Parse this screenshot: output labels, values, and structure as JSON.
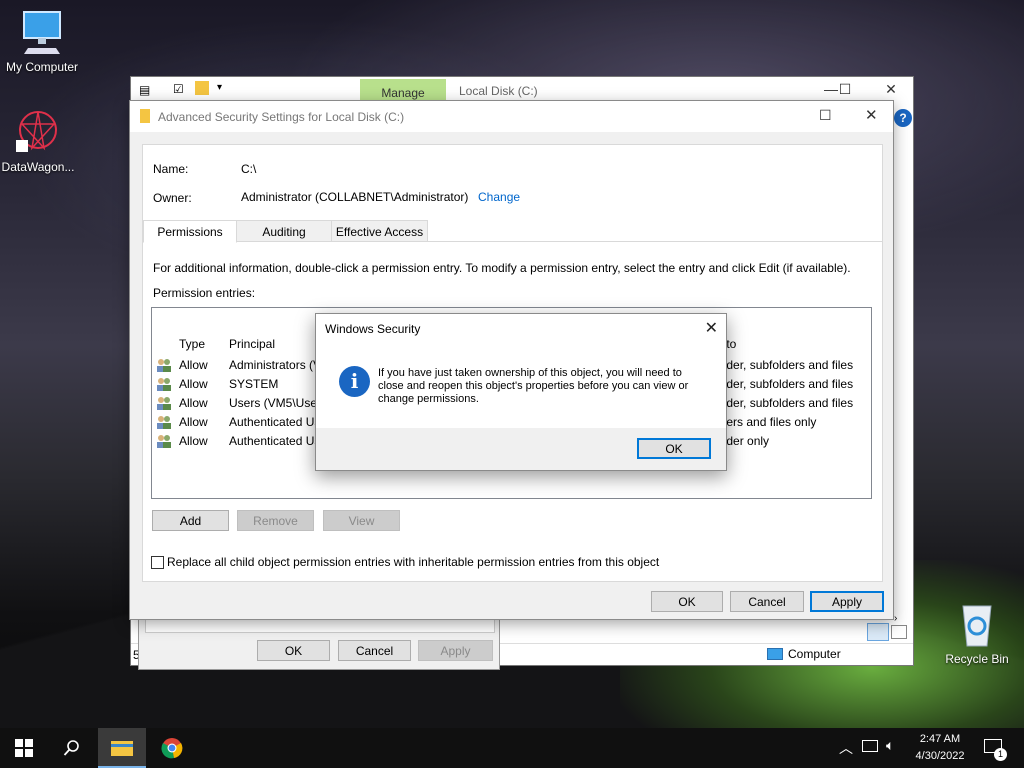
{
  "desktop": {
    "icons": [
      {
        "label": "My Computer"
      },
      {
        "label": "DataWagon..."
      },
      {
        "label": "Recycle Bin"
      }
    ]
  },
  "explorer": {
    "manage_tab": "Manage",
    "title": "Local Disk (C:)",
    "status_item": "Computer",
    "status_left": "5"
  },
  "props_dialog": {
    "ok": "OK",
    "cancel": "Cancel",
    "apply": "Apply"
  },
  "adv": {
    "title": "Advanced Security Settings for Local Disk (C:)",
    "name_label": "Name:",
    "name_value": "C:\\",
    "owner_label": "Owner:",
    "owner_value": "Administrator (COLLABNET\\Administrator)",
    "change_link": "Change",
    "tabs": [
      "Permissions",
      "Auditing",
      "Effective Access"
    ],
    "info_text": "For additional information, double-click a permission entry. To modify a permission entry, select the entry and click Edit (if available).",
    "entries_label": "Permission entries:",
    "columns": {
      "type": "Type",
      "principal": "Principal",
      "applies": "s to"
    },
    "rows": [
      {
        "type": "Allow",
        "principal": "Administrators (V",
        "applies": "older, subfolders and files"
      },
      {
        "type": "Allow",
        "principal": "SYSTEM",
        "applies": "older, subfolders and files"
      },
      {
        "type": "Allow",
        "principal": "Users (VM5\\User",
        "applies": "older, subfolders and files"
      },
      {
        "type": "Allow",
        "principal": "Authenticated Us",
        "applies": "lders and files only"
      },
      {
        "type": "Allow",
        "principal": "Authenticated Us",
        "applies": "older only"
      }
    ],
    "add": "Add",
    "remove": "Remove",
    "view": "View",
    "replace_checkbox": "Replace all child object permission entries with inheritable permission entries from this object",
    "ok": "OK",
    "cancel": "Cancel",
    "apply": "Apply"
  },
  "msgbox": {
    "title": "Windows Security",
    "message": "If you have just taken ownership of this object, you will need to close and reopen this object's properties before you can view or change permissions.",
    "ok": "OK"
  },
  "taskbar": {
    "time": "2:47 AM",
    "date": "4/30/2022",
    "notification_count": "1"
  }
}
